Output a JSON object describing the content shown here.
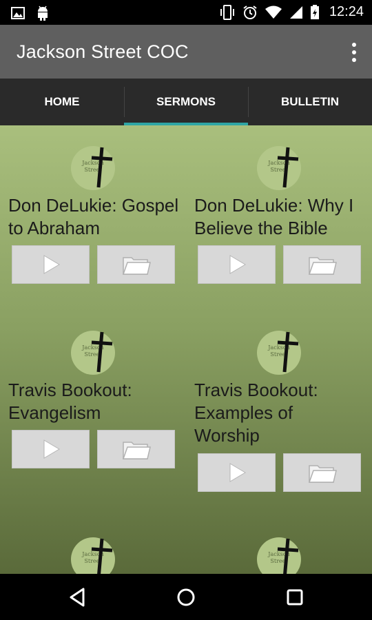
{
  "status_bar": {
    "time": "12:24",
    "left_icons": [
      "image-notification-icon",
      "android-notification-icon"
    ],
    "right_icons": [
      "vibrate-icon",
      "alarm-icon",
      "wifi-icon",
      "signal-icon",
      "battery-icon"
    ]
  },
  "app_bar": {
    "title": "Jackson Street COC",
    "overflow_icon": "more-vert-icon"
  },
  "tabs": [
    {
      "label": "HOME",
      "active": false
    },
    {
      "label": "SERMONS",
      "active": true
    },
    {
      "label": "BULLETIN",
      "active": false
    }
  ],
  "logo": {
    "text_line1": "Jackson",
    "text_line2": "Street"
  },
  "sermons": [
    {
      "title": "Don DeLukie: Gospel to Abraham"
    },
    {
      "title": "Don DeLukie: Why I Believe the Bible"
    },
    {
      "title": "Travis Bookout: Evangelism"
    },
    {
      "title": "Travis Bookout: Examples of Worship"
    }
  ],
  "buttons": {
    "play_icon": "play-icon",
    "folder_icon": "folder-icon"
  },
  "nav_bar": {
    "icons": [
      "back-icon",
      "home-icon",
      "recents-icon"
    ]
  },
  "colors": {
    "accent": "#2fa5a5",
    "app_bar": "#5f5f5f",
    "tab_bar": "#2a2a2a"
  }
}
